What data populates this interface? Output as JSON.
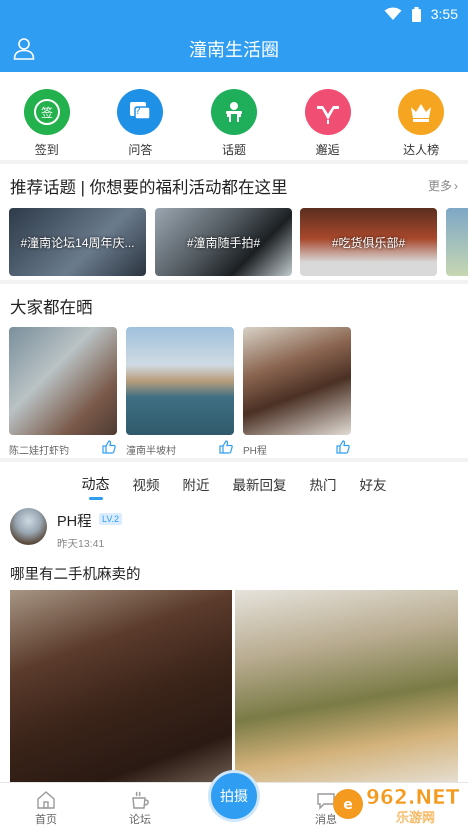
{
  "status": {
    "time": "3:55"
  },
  "header": {
    "title": "潼南生活圈"
  },
  "quick": [
    {
      "label": "签到",
      "icon": "sign-in-icon",
      "glyph": "签",
      "color": "#22b14c"
    },
    {
      "label": "问答",
      "icon": "qa-icon",
      "glyph": "?",
      "color": "#1e90e6"
    },
    {
      "label": "话题",
      "icon": "topic-icon",
      "glyph": "",
      "color": "#1fae5a"
    },
    {
      "label": "邂逅",
      "icon": "encounter-icon",
      "glyph": "",
      "color": "#f04f73"
    },
    {
      "label": "达人榜",
      "icon": "crown-icon",
      "glyph": "",
      "color": "#f6a521"
    }
  ],
  "topics": {
    "title": "推荐话题 | 你想要的福利活动都在这里",
    "more": "更多",
    "items": [
      "#潼南论坛14周年庆...",
      "#潼南随手拍#",
      "#吃货俱乐部#"
    ]
  },
  "photos": {
    "title": "大家都在晒",
    "items": [
      "陈二娃打虾钓",
      "潼南半坡村",
      "PH程"
    ]
  },
  "feed_tabs": [
    "动态",
    "视频",
    "附近",
    "最新回复",
    "热门",
    "好友"
  ],
  "post": {
    "author": "PH程",
    "level": "LV.2",
    "time": "昨天13:41",
    "title": "哪里有二手机麻卖的"
  },
  "nav": {
    "home": "首页",
    "forum": "论坛",
    "shoot": "拍摄",
    "message": "消息"
  },
  "watermark": "962.NET 乐游网",
  "colors": {
    "primary": "#2f9ef2"
  }
}
